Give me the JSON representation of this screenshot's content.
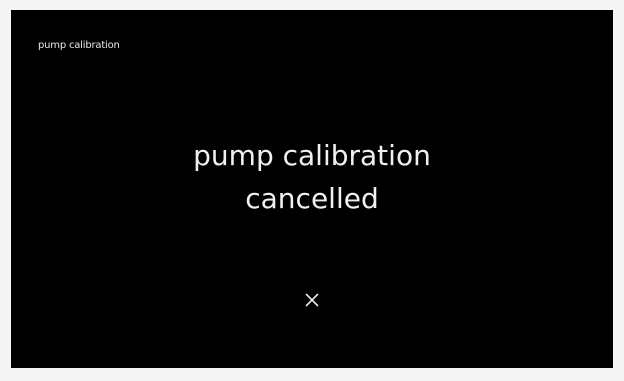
{
  "header": {
    "title": "pump calibration"
  },
  "message": {
    "line1": "pump calibration",
    "line2": "cancelled"
  },
  "close_button": {
    "icon": "close-icon"
  },
  "colors": {
    "screen_background": "#000000",
    "text": "#f0f0f0",
    "frame": "#f5f5f5"
  }
}
